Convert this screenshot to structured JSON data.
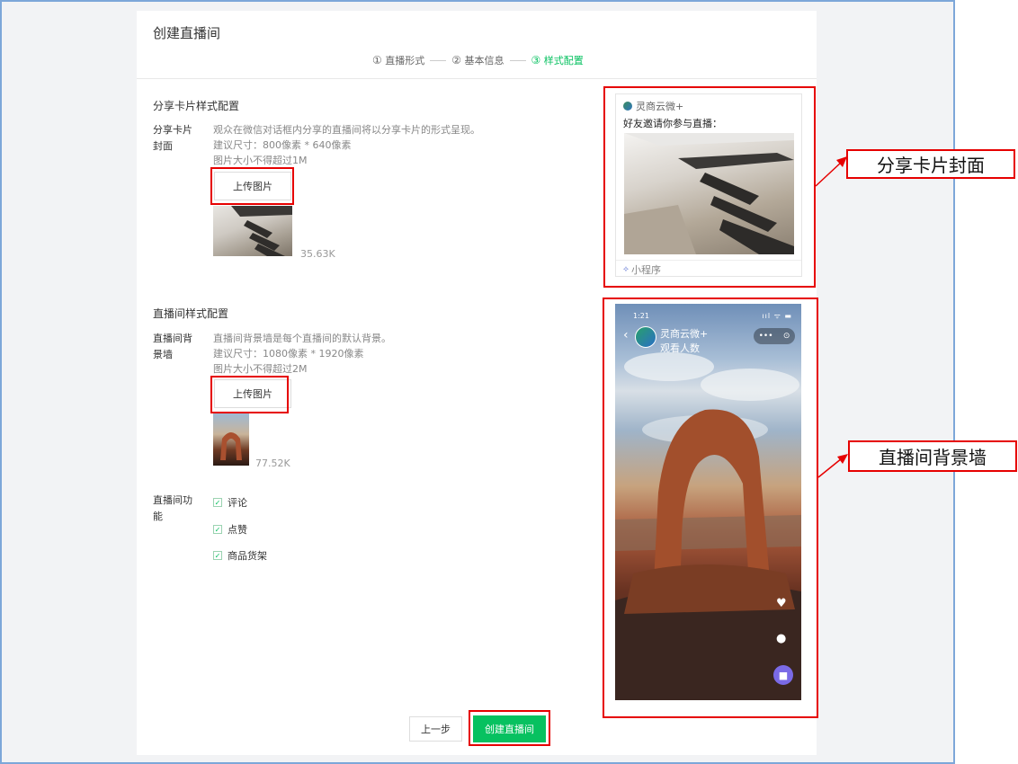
{
  "page_title": "创建直播间",
  "steps": [
    {
      "num": "①",
      "label": "直播形式"
    },
    {
      "num": "②",
      "label": "基本信息"
    },
    {
      "num": "③",
      "label": "样式配置"
    }
  ],
  "share_section": {
    "title": "分享卡片样式配置",
    "label": "分享卡片封面",
    "desc_lines": [
      "观众在微信对话框内分享的直播间将以分享卡片的形式呈现。",
      "建议尺寸：800像素 * 640像素",
      "图片大小不得超过1M"
    ],
    "upload_label": "上传图片",
    "file_size": "35.63K"
  },
  "room_section": {
    "title": "直播间样式配置",
    "bg_label": "直播间背景墙",
    "desc_lines": [
      "直播间背景墙是每个直播间的默认背景。",
      "建议尺寸：1080像素 * 1920像素",
      "图片大小不得超过2M"
    ],
    "upload_label": "上传图片",
    "file_size": "77.52K",
    "feature_label": "直播间功能",
    "features": [
      "评论",
      "点赞",
      "商品货架"
    ]
  },
  "footer": {
    "prev_label": "上一步",
    "create_label": "创建直播间"
  },
  "card_preview": {
    "app_name": "灵商云微+",
    "invite_text": "好友邀请你参与直播：",
    "footer_text": "小程序"
  },
  "phone_preview": {
    "time": "1:21",
    "status": "ııl ᯤ ▬",
    "host_name": "灵商云微+",
    "viewers": "观看人数",
    "capsule_more": "•••",
    "capsule_close": "⊙"
  },
  "callouts": {
    "share_cover": "分享卡片封面",
    "room_bg": "直播间背景墙"
  },
  "colors": {
    "accent": "#07c160",
    "highlight": "#e60000",
    "frame": "#7da7d9"
  }
}
